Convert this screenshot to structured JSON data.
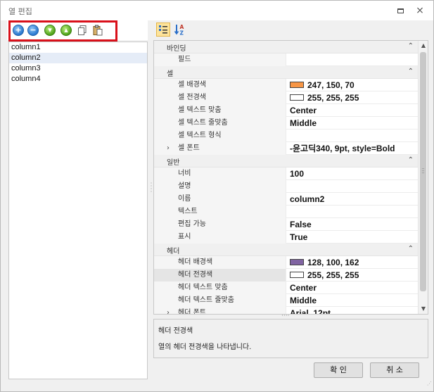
{
  "window": {
    "title": "열 편집",
    "restore_icon": "restore-icon",
    "close_label": "⨯"
  },
  "toolbar_left": {
    "buttons": [
      {
        "name": "add-button",
        "icon": "plus-circle-icon",
        "color": "#2a78cf"
      },
      {
        "name": "remove-button",
        "icon": "minus-circle-icon",
        "color": "#2a78cf"
      },
      {
        "name": "move-down-button",
        "icon": "down-circle-icon",
        "color": "#4ea21a"
      },
      {
        "name": "move-up-button",
        "icon": "up-circle-icon",
        "color": "#4ea21a"
      },
      {
        "name": "copy-button",
        "icon": "copy-icon"
      },
      {
        "name": "paste-button",
        "icon": "paste-icon"
      }
    ],
    "highlight_color": "#d9101a"
  },
  "column_list": {
    "items": [
      "column1",
      "column2",
      "column3",
      "column4"
    ],
    "selected_index": 1
  },
  "toolbar_right": {
    "categorized_icon": "categorized-view-icon",
    "alphabetical_icon": "alphabetical-sort-icon"
  },
  "property_grid": {
    "categories": [
      {
        "label": "바인딩",
        "rows": [
          {
            "name": "필드",
            "value": ""
          }
        ]
      },
      {
        "label": "셀",
        "rows": [
          {
            "name": "셀 배경색",
            "value": "247, 150, 70",
            "swatch": "#f79646"
          },
          {
            "name": "셀 전경색",
            "value": "255, 255, 255",
            "swatch": "#ffffff"
          },
          {
            "name": "셀 텍스트 맞춤",
            "value": "Center"
          },
          {
            "name": "셀 텍스트 줄맞춤",
            "value": "Middle"
          },
          {
            "name": "셀 텍스트 형식",
            "value": ""
          },
          {
            "name": "셀 폰트",
            "value": "-윤고딕340, 9pt, style=Bold",
            "expandable": true
          }
        ]
      },
      {
        "label": "일반",
        "rows": [
          {
            "name": "너비",
            "value": "100"
          },
          {
            "name": "설명",
            "value": ""
          },
          {
            "name": "이름",
            "value": "column2"
          },
          {
            "name": "텍스트",
            "value": ""
          },
          {
            "name": "편집 가능",
            "value": "False"
          },
          {
            "name": "표시",
            "value": "True"
          }
        ]
      },
      {
        "label": "헤더",
        "rows": [
          {
            "name": "헤더 배경색",
            "value": "128, 100, 162",
            "swatch": "#8064a2"
          },
          {
            "name": "헤더 전경색",
            "value": "255, 255, 255",
            "swatch": "#ffffff",
            "highlighted": true
          },
          {
            "name": "헤더 텍스트 맞춤",
            "value": "Center"
          },
          {
            "name": "헤더 텍스트 줄맞춤",
            "value": "Middle"
          },
          {
            "name": "헤더 폰트",
            "value": "Arial, 12pt",
            "expandable": true
          }
        ]
      }
    ]
  },
  "description": {
    "title": "헤더 전경색",
    "text": "열의 헤더 전경색을 나타냅니다."
  },
  "buttons": {
    "ok": "확 인",
    "cancel": "취 소"
  }
}
